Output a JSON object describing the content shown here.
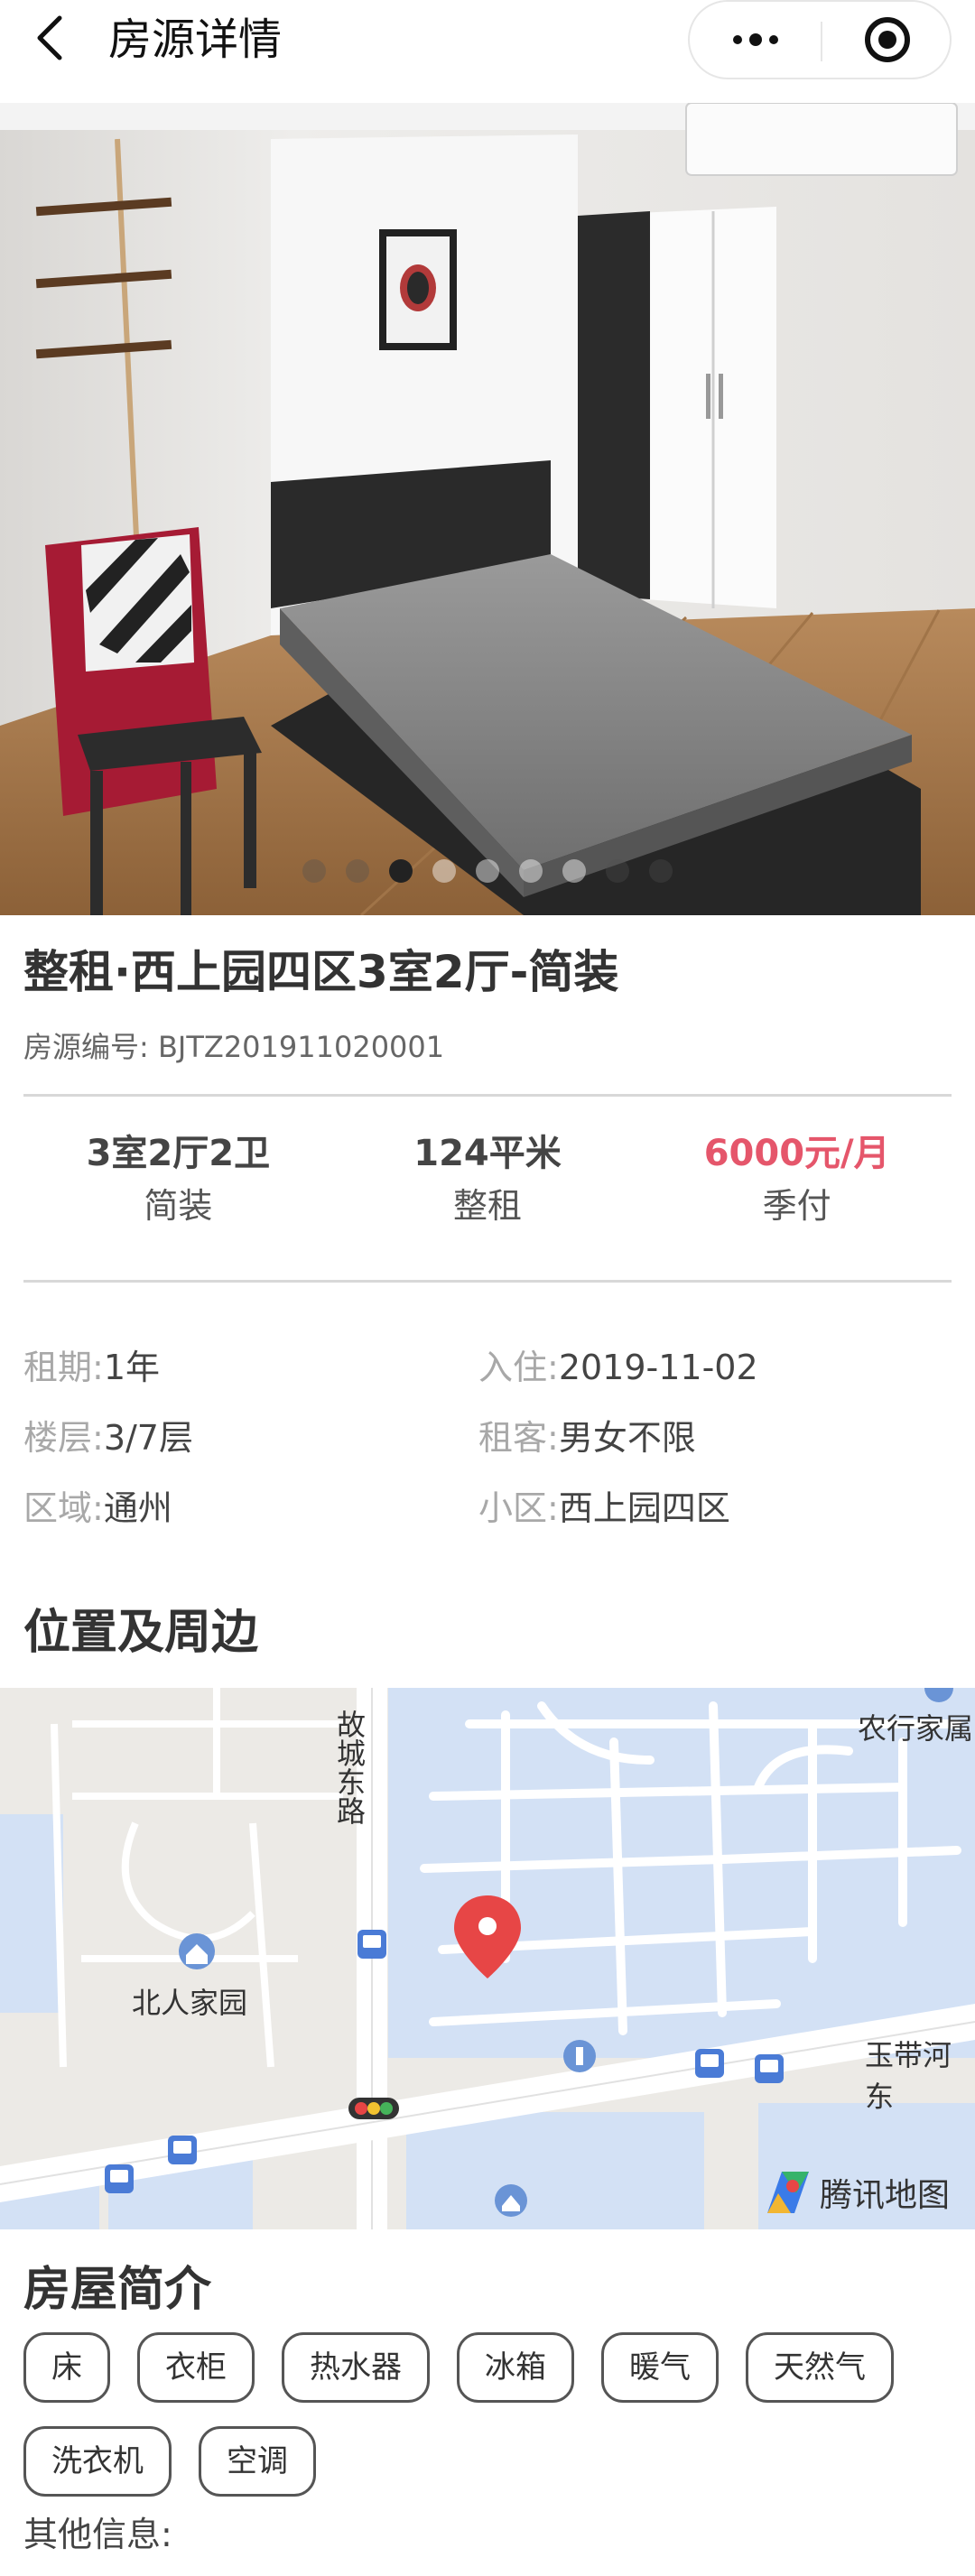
{
  "header": {
    "title": "房源详情",
    "back_icon": "chevron-left-icon",
    "more_icon": "more-dots-icon",
    "close_icon": "target-close-icon"
  },
  "gallery": {
    "slide_count": 9,
    "active_index": 2,
    "image_description_icon": "bedroom-photo"
  },
  "house": {
    "title": "整租·西上园四区3室2厅-简装",
    "id_text": "房源编号: BJTZ201911020001"
  },
  "stats": [
    {
      "main": "3室2厅2卫",
      "sub": "简装"
    },
    {
      "main": "124平米",
      "sub": "整租"
    },
    {
      "main": "6000元/月",
      "sub": "季付",
      "color": "#e5566b"
    }
  ],
  "props": [
    {
      "label": "租期:",
      "value": "1年"
    },
    {
      "label": "入住:",
      "value": "2019-11-02"
    },
    {
      "label": "楼层:",
      "value": "3/7层"
    },
    {
      "label": "租客:",
      "value": "男女不限"
    },
    {
      "label": "区域:",
      "value": "通州"
    },
    {
      "label": "小区:",
      "value": "西上园四区"
    }
  ],
  "location": {
    "section_title": "位置及周边",
    "labels": {
      "road": "故城东路",
      "park": "北人家园",
      "bank": "农行家属",
      "river": "玉带河东",
      "brand": "腾讯地图"
    }
  },
  "intro": {
    "section_title": "房屋简介",
    "facilities": [
      "床",
      "衣柜",
      "热水器",
      "冰箱",
      "暖气",
      "天然气",
      "洗衣机",
      "空调"
    ],
    "other_info_label": "其他信息:"
  },
  "colors": {
    "price": "#e5566b",
    "map_blocks": "#d3e1f5",
    "map_marker": "#e74646"
  }
}
